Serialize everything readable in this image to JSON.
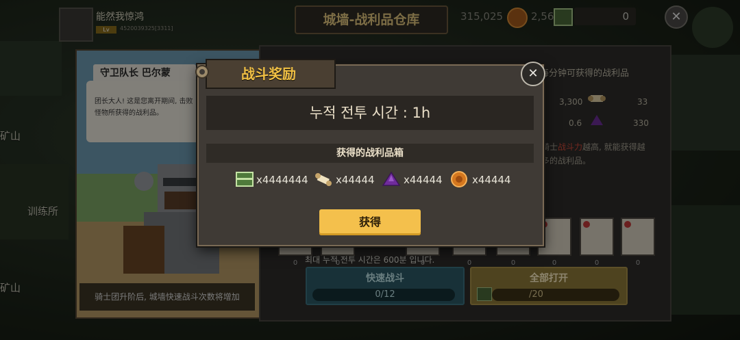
{
  "header": {
    "player_name": "能然我惊鸿",
    "player_level": "Lv",
    "player_id": "4520039325[3311]",
    "title": "城墙-战利品仓库",
    "gold": "315,025",
    "food": "2,56",
    "chest_count": "0",
    "close_icon": "close-icon"
  },
  "side_labels": [
    "矿山",
    "训练所",
    "矿山"
  ],
  "character": {
    "name": "守卫队长 巴尔蒙",
    "speech": "团长大人! 这是您离开期间, 击败怪物所获得的战利品。",
    "footer": "骑士团升阶后, 城墙快速战斗次数将增加"
  },
  "right_panel": {
    "header": "每分钟可获得的战利品",
    "rate_scroll": "3,300",
    "rate_scroll_right": "33",
    "rate_gem": "0.6",
    "rate_gem_right": "330",
    "note_prefix": "骑士",
    "note_highlight": "战斗力",
    "note_suffix": "越高, 就能获得越多的战利品。",
    "slot_values": [
      "0",
      "0",
      "0",
      "0",
      "0",
      "0",
      "0",
      "0"
    ],
    "max_note": "최대 누적 전투 시간은 600분 입니다.",
    "fast_battle_label": "快速战斗",
    "fast_battle_count": "0/12",
    "open_all_label": "全部打开",
    "open_all_count": "/20"
  },
  "modal": {
    "title": "战斗奖励",
    "time_text": "누적 전투 시간 : 1h",
    "chest_header": "获得的战利品箱",
    "items": [
      {
        "icon": "treasure-chest-icon",
        "count": "x4444444"
      },
      {
        "icon": "scroll-icon",
        "count": "x44444"
      },
      {
        "icon": "purple-gem-icon",
        "count": "x44444"
      },
      {
        "icon": "food-coin-icon",
        "count": "x44444"
      }
    ],
    "get_button": "获得"
  }
}
